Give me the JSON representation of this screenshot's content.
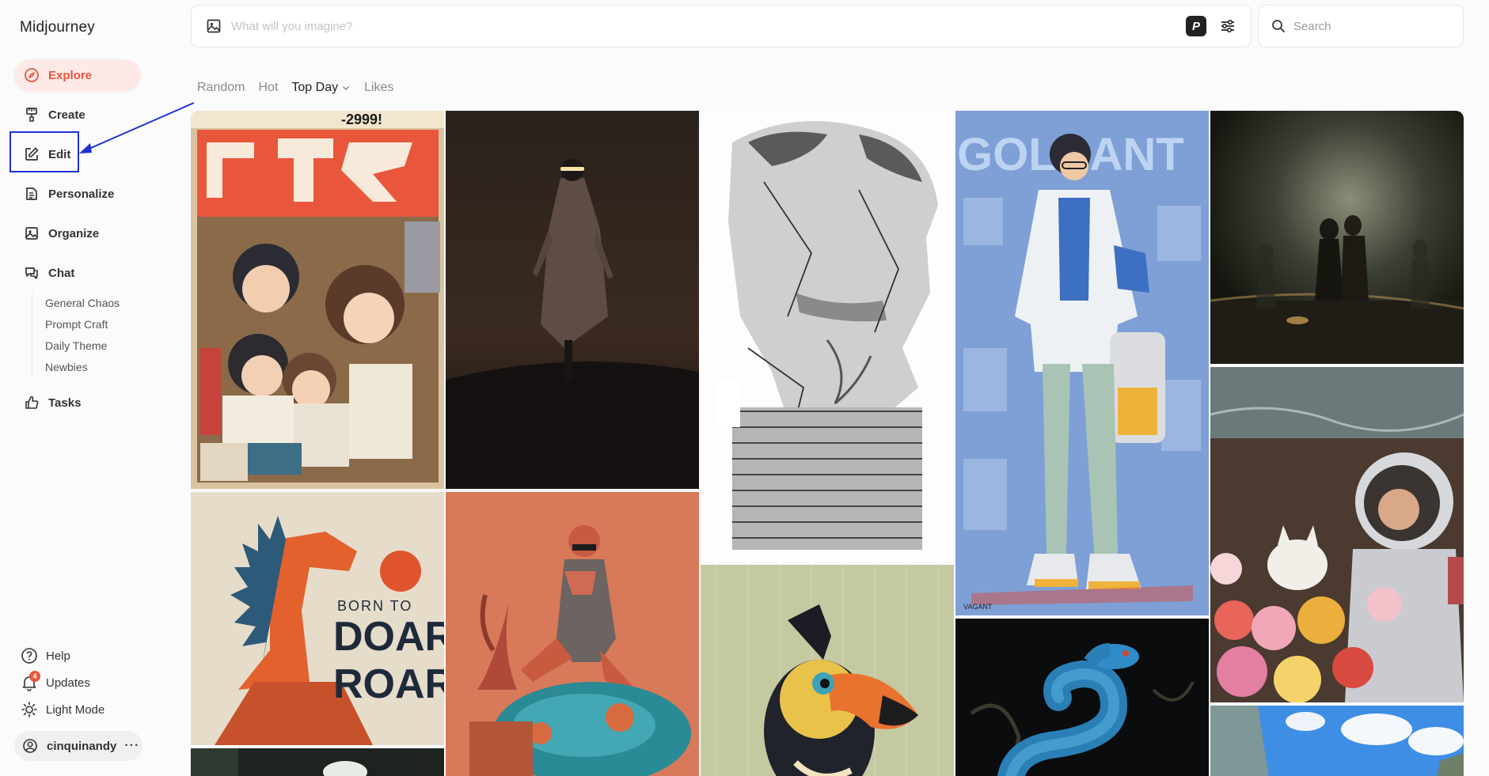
{
  "app": {
    "name": "Midjourney"
  },
  "nav": {
    "items": [
      {
        "label": "Explore",
        "icon": "compass-icon",
        "active": true
      },
      {
        "label": "Create",
        "icon": "brush-icon"
      },
      {
        "label": "Edit",
        "icon": "edit-icon"
      },
      {
        "label": "Personalize",
        "icon": "personalize-icon"
      },
      {
        "label": "Organize",
        "icon": "image-icon"
      },
      {
        "label": "Chat",
        "icon": "chat-icon"
      },
      {
        "label": "Tasks",
        "icon": "thumbs-up-icon"
      }
    ],
    "chat_channels": [
      "General Chaos",
      "Prompt Craft",
      "Daily Theme",
      "Newbies"
    ]
  },
  "bottom": {
    "help": "Help",
    "updates": "Updates",
    "updates_count": "4",
    "light_mode": "Light Mode",
    "user": "cinquinandy",
    "more": "···"
  },
  "prompt": {
    "placeholder": "What will you imagine?",
    "p_label": "P"
  },
  "search": {
    "placeholder": "Search"
  },
  "tabs": [
    {
      "label": "Random"
    },
    {
      "label": "Hot"
    },
    {
      "label": "Top Day",
      "active": true
    },
    {
      "label": "Likes"
    }
  ],
  "images": {
    "anime_poster_header": "-2999!",
    "dino_line1": "BORN TO",
    "dino_line2": "DOAR",
    "dino_line3": "ROAR",
    "goldant_title": "GOLDANT",
    "goldant_signature": "VAGANT"
  },
  "colors": {
    "accent": "#e8553e",
    "highlight": "#1f2fd6"
  }
}
